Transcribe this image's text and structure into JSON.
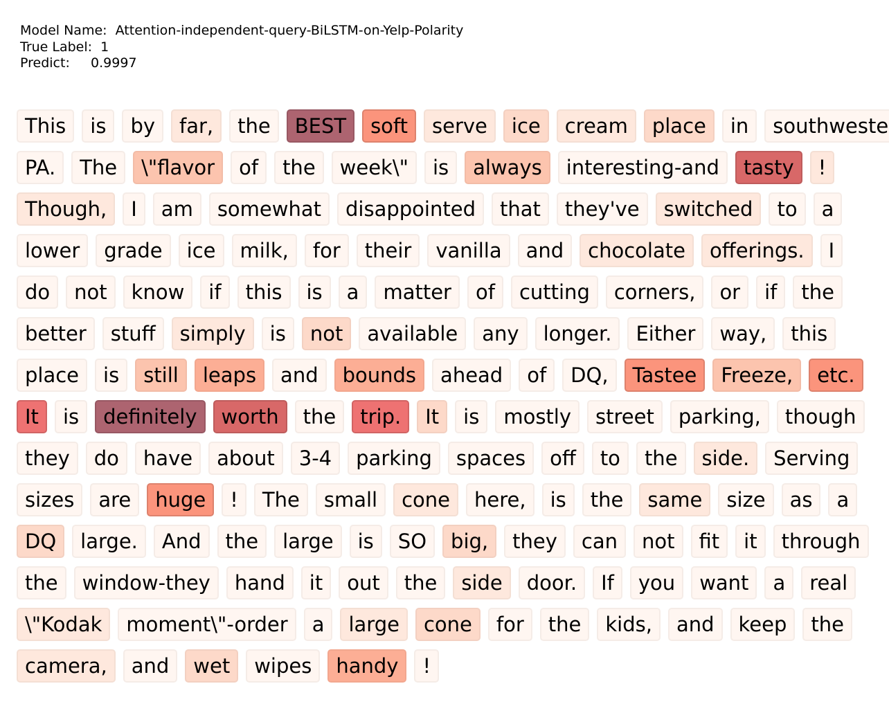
{
  "header": {
    "model_name_label": "Model Name:",
    "model_name": "Attention-independent-query-BiLSTM-on-Yelp-Polarity",
    "true_label_label": "True Label:",
    "true_label": "1",
    "predict_label": "Predict:",
    "predict": "0.9997"
  },
  "colors": {
    "0": "#fff6f1",
    "1": "#fee8dd",
    "2": "#fdd9c9",
    "3": "#fcc4ae",
    "4": "#fcae95",
    "5": "#fb947c",
    "6": "#ee7272",
    "7": "#d86868",
    "8": "#ad6470"
  },
  "lines": [
    [
      [
        "This",
        0
      ],
      [
        "is",
        0
      ],
      [
        "by",
        0
      ],
      [
        "far,",
        1
      ],
      [
        "the",
        0
      ],
      [
        "BEST",
        8
      ],
      [
        "soft",
        5
      ],
      [
        "serve",
        1
      ],
      [
        "ice",
        2
      ],
      [
        "cream",
        1
      ],
      [
        "place",
        2
      ],
      [
        "in",
        0
      ],
      [
        "southwestern",
        0
      ]
    ],
    [
      [
        "PA.",
        0
      ],
      [
        "The",
        0
      ],
      [
        "\\\"flavor",
        3
      ],
      [
        "of",
        0
      ],
      [
        "the",
        0
      ],
      [
        "week\\\"",
        0
      ],
      [
        "is",
        0
      ],
      [
        "always",
        3
      ],
      [
        "interesting-and",
        0
      ],
      [
        "tasty",
        7
      ],
      [
        "!",
        1
      ]
    ],
    [
      [
        "Though,",
        1
      ],
      [
        "I",
        0
      ],
      [
        "am",
        0
      ],
      [
        "somewhat",
        0
      ],
      [
        "disappointed",
        0
      ],
      [
        "that",
        0
      ],
      [
        "they've",
        0
      ],
      [
        "switched",
        1
      ],
      [
        "to",
        0
      ],
      [
        "a",
        0
      ]
    ],
    [
      [
        "lower",
        0
      ],
      [
        "grade",
        0
      ],
      [
        "ice",
        0
      ],
      [
        "milk,",
        0
      ],
      [
        "for",
        0
      ],
      [
        "their",
        0
      ],
      [
        "vanilla",
        0
      ],
      [
        "and",
        0
      ],
      [
        "chocolate",
        1
      ],
      [
        "offerings.",
        1
      ],
      [
        "I",
        0
      ]
    ],
    [
      [
        "do",
        0
      ],
      [
        "not",
        0
      ],
      [
        "know",
        0
      ],
      [
        "if",
        0
      ],
      [
        "this",
        0
      ],
      [
        "is",
        0
      ],
      [
        "a",
        0
      ],
      [
        "matter",
        0
      ],
      [
        "of",
        0
      ],
      [
        "cutting",
        0
      ],
      [
        "corners,",
        0
      ],
      [
        "or",
        0
      ],
      [
        "if",
        0
      ],
      [
        "the",
        0
      ]
    ],
    [
      [
        "better",
        0
      ],
      [
        "stuff",
        0
      ],
      [
        "simply",
        1
      ],
      [
        "is",
        0
      ],
      [
        "not",
        2
      ],
      [
        "available",
        0
      ],
      [
        "any",
        0
      ],
      [
        "longer.",
        0
      ],
      [
        "Either",
        0
      ],
      [
        "way,",
        0
      ],
      [
        "this",
        0
      ]
    ],
    [
      [
        "place",
        0
      ],
      [
        "is",
        0
      ],
      [
        "still",
        3
      ],
      [
        "leaps",
        4
      ],
      [
        "and",
        0
      ],
      [
        "bounds",
        4
      ],
      [
        "ahead",
        0
      ],
      [
        "of",
        0
      ],
      [
        "DQ,",
        0
      ],
      [
        "Tastee",
        5
      ],
      [
        "Freeze,",
        3
      ],
      [
        "etc.",
        5
      ]
    ],
    [
      [
        "It",
        6
      ],
      [
        "is",
        0
      ],
      [
        "definitely",
        8
      ],
      [
        "worth",
        7
      ],
      [
        "the",
        0
      ],
      [
        "trip.",
        6
      ],
      [
        "It",
        2
      ],
      [
        "is",
        0
      ],
      [
        "mostly",
        0
      ],
      [
        "street",
        0
      ],
      [
        "parking,",
        0
      ],
      [
        "though",
        0
      ]
    ],
    [
      [
        "they",
        0
      ],
      [
        "do",
        0
      ],
      [
        "have",
        0
      ],
      [
        "about",
        0
      ],
      [
        "3-4",
        0
      ],
      [
        "parking",
        0
      ],
      [
        "spaces",
        0
      ],
      [
        "off",
        0
      ],
      [
        "to",
        0
      ],
      [
        "the",
        0
      ],
      [
        "side.",
        1
      ],
      [
        "Serving",
        0
      ]
    ],
    [
      [
        "sizes",
        0
      ],
      [
        "are",
        0
      ],
      [
        "huge",
        5
      ],
      [
        "!",
        0
      ],
      [
        "The",
        0
      ],
      [
        "small",
        0
      ],
      [
        "cone",
        1
      ],
      [
        "here,",
        0
      ],
      [
        "is",
        0
      ],
      [
        "the",
        0
      ],
      [
        "same",
        1
      ],
      [
        "size",
        0
      ],
      [
        "as",
        0
      ],
      [
        "a",
        0
      ]
    ],
    [
      [
        "DQ",
        2
      ],
      [
        "large.",
        0
      ],
      [
        "And",
        0
      ],
      [
        "the",
        0
      ],
      [
        "large",
        0
      ],
      [
        "is",
        0
      ],
      [
        "SO",
        0
      ],
      [
        "big,",
        2
      ],
      [
        "they",
        0
      ],
      [
        "can",
        0
      ],
      [
        "not",
        0
      ],
      [
        "fit",
        0
      ],
      [
        "it",
        0
      ],
      [
        "through",
        0
      ]
    ],
    [
      [
        "the",
        0
      ],
      [
        "window-they",
        0
      ],
      [
        "hand",
        0
      ],
      [
        "it",
        0
      ],
      [
        "out",
        0
      ],
      [
        "the",
        0
      ],
      [
        "side",
        1
      ],
      [
        "door.",
        0
      ],
      [
        "If",
        0
      ],
      [
        "you",
        0
      ],
      [
        "want",
        0
      ],
      [
        "a",
        0
      ],
      [
        "real",
        0
      ]
    ],
    [
      [
        "\\\"Kodak",
        1
      ],
      [
        "moment\\\"-order",
        0
      ],
      [
        "a",
        0
      ],
      [
        "large",
        1
      ],
      [
        "cone",
        2
      ],
      [
        "for",
        0
      ],
      [
        "the",
        0
      ],
      [
        "kids,",
        0
      ],
      [
        "and",
        0
      ],
      [
        "keep",
        0
      ],
      [
        "the",
        0
      ]
    ],
    [
      [
        "camera,",
        1
      ],
      [
        "and",
        0
      ],
      [
        "wet",
        2
      ],
      [
        "wipes",
        0
      ],
      [
        "handy",
        4
      ],
      [
        "!",
        0
      ]
    ]
  ]
}
